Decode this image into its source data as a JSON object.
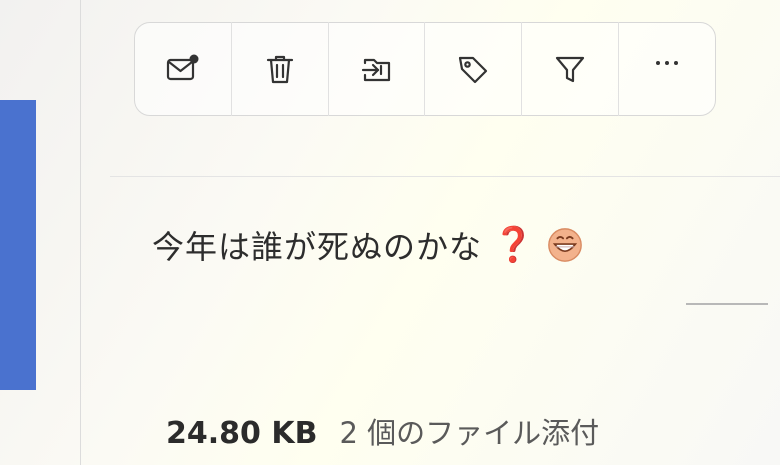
{
  "toolbar": {
    "buttons": [
      {
        "icon": "mark-unread-icon"
      },
      {
        "icon": "trash-icon"
      },
      {
        "icon": "move-to-folder-icon"
      },
      {
        "icon": "tag-icon"
      },
      {
        "icon": "filter-icon"
      },
      {
        "icon": "more-icon",
        "label": "···"
      }
    ]
  },
  "message": {
    "text": "今年は誰が死ぬのかな",
    "question_mark": "❓",
    "emoji": "grinning-face-icon"
  },
  "attachment": {
    "size": "24.80 KB",
    "count_label": "2 個のファイル添付"
  },
  "colors": {
    "accent": "#4a72cf",
    "question": "#d6214d",
    "emoji_face": "#f3b28c"
  }
}
